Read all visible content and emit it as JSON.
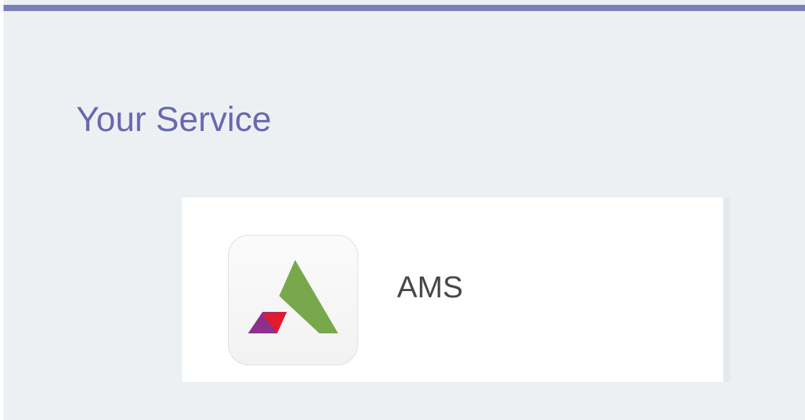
{
  "page": {
    "title": "Your Service"
  },
  "service": {
    "name": "AMS",
    "icon": "ams-logo-icon"
  },
  "colors": {
    "accent": "#7a80b8",
    "title": "#6868b2",
    "logo_green": "#78a84b",
    "logo_red": "#e11b2b",
    "logo_purple": "#8d2f8d"
  }
}
